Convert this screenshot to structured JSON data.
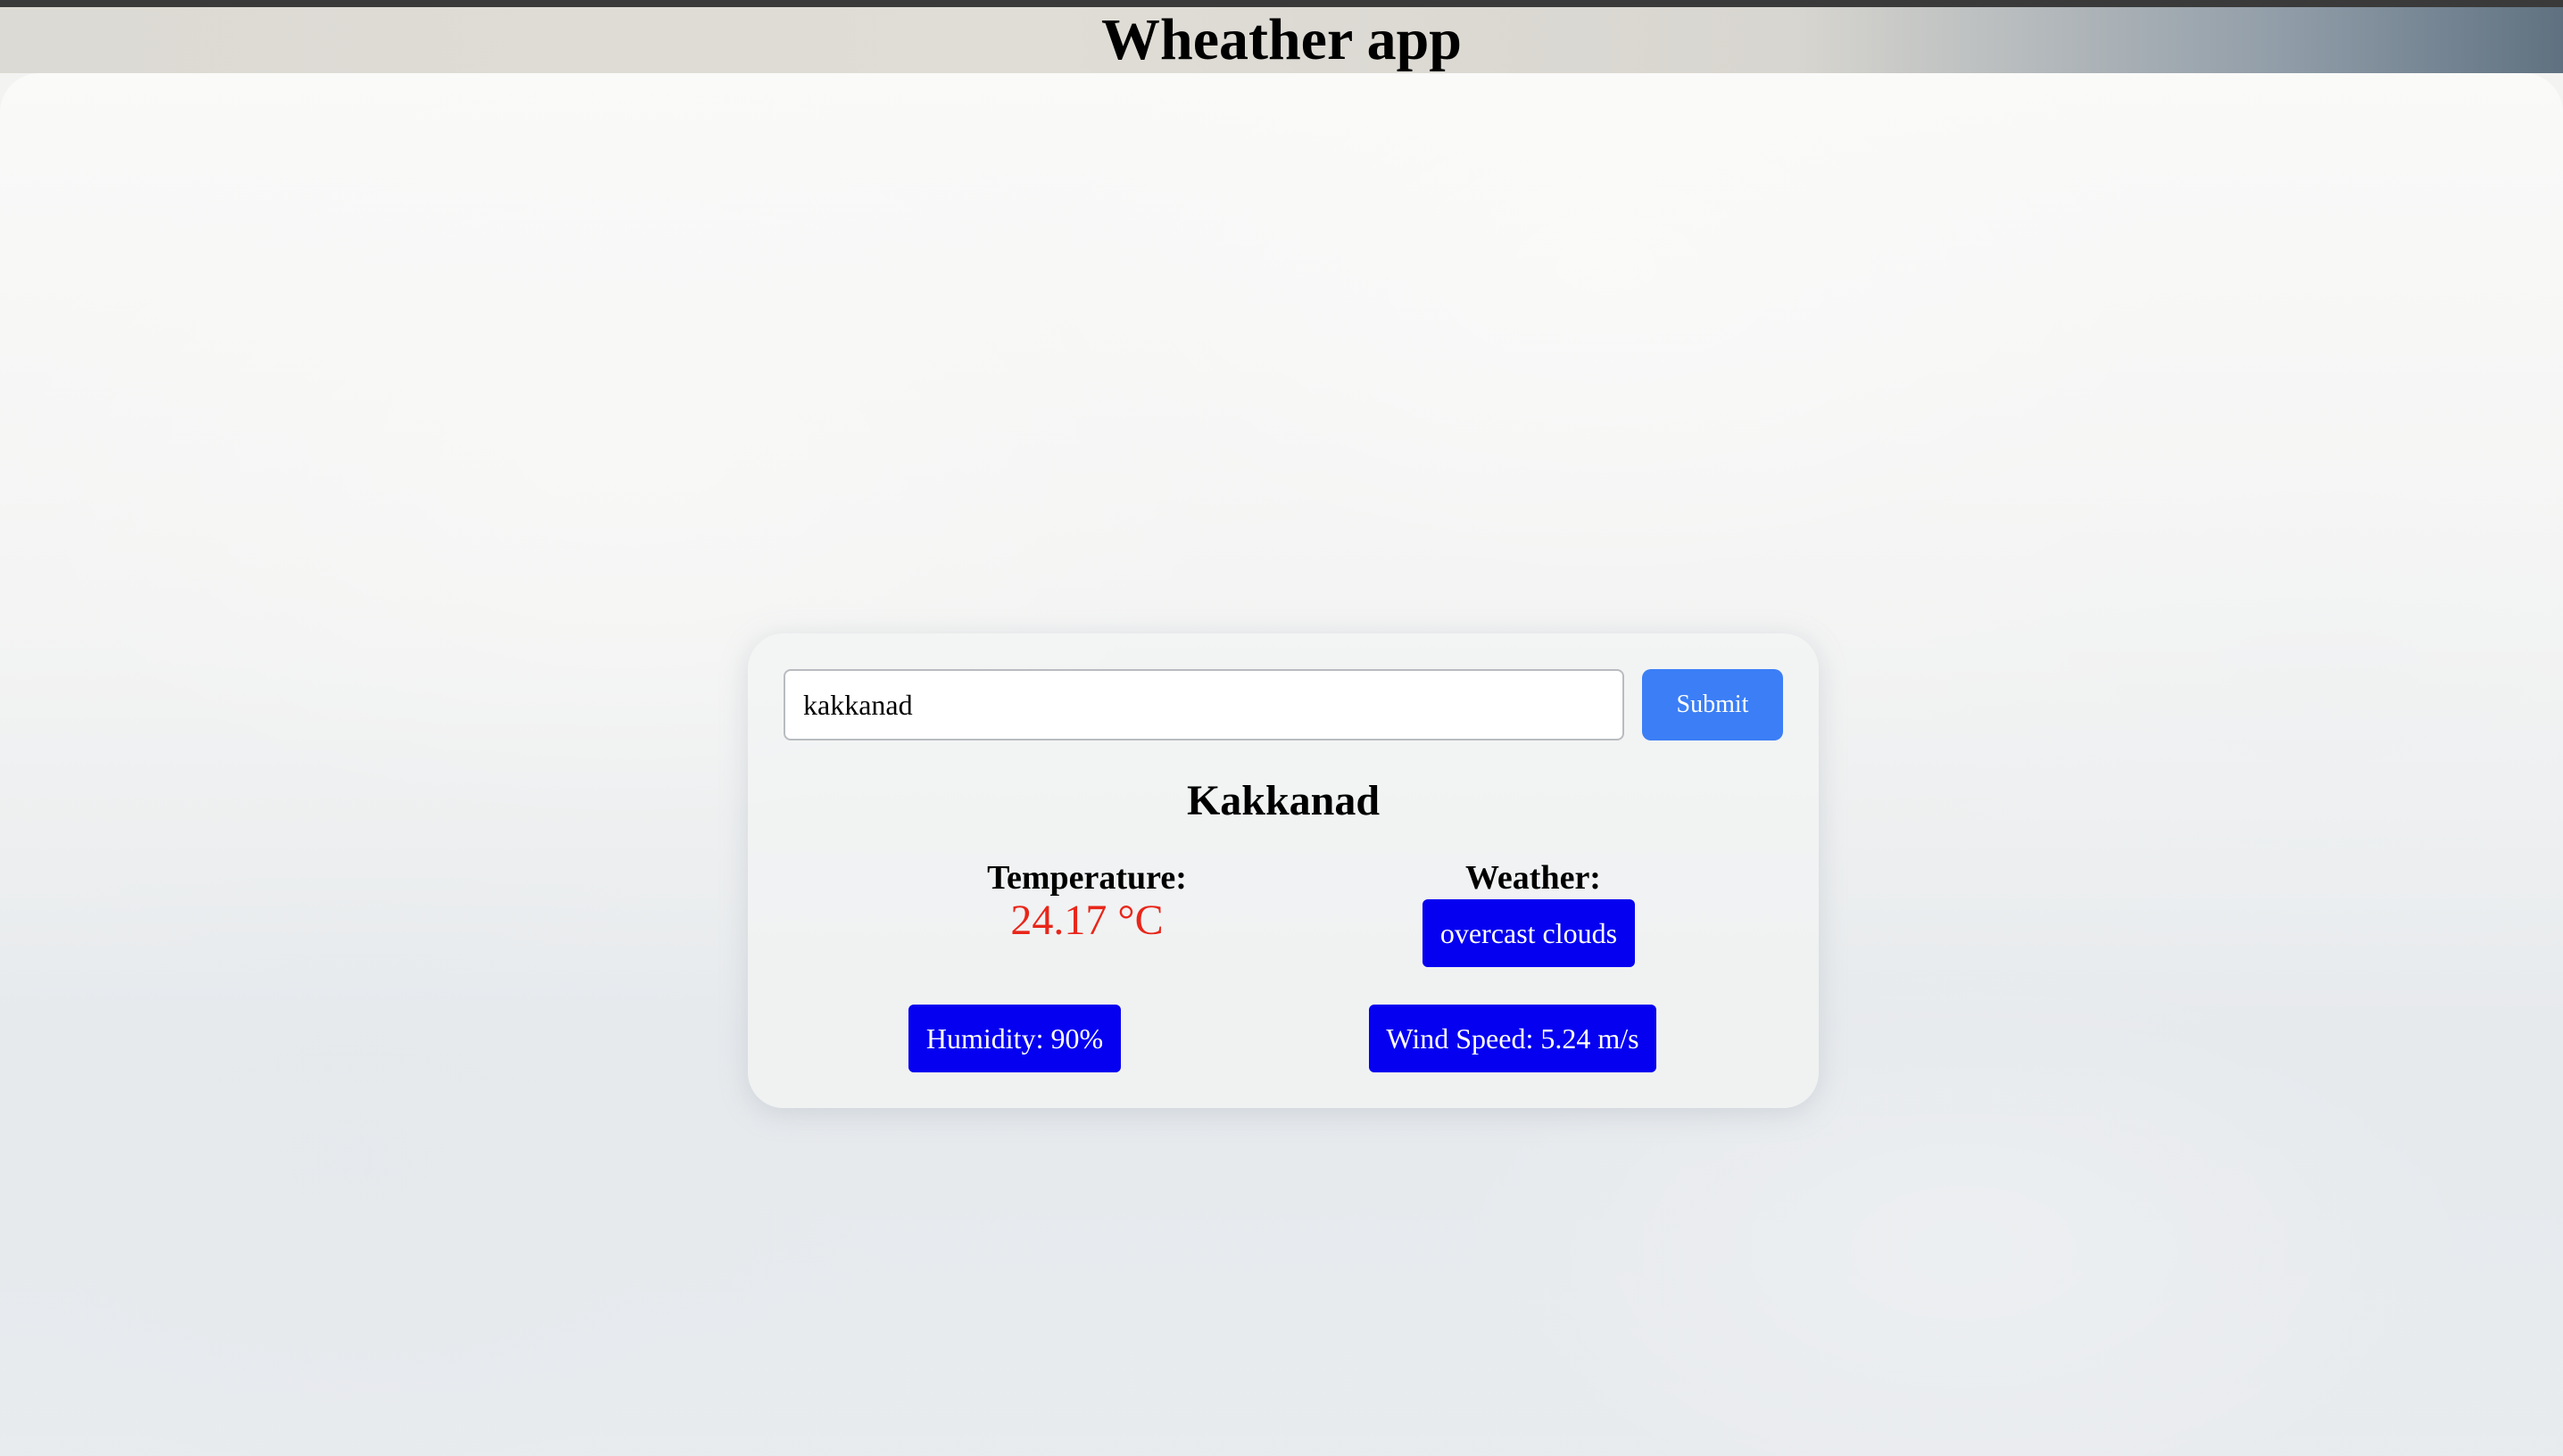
{
  "header": {
    "title": "Wheather app"
  },
  "search": {
    "value": "kakkanad",
    "submit_label": "Submit"
  },
  "weather": {
    "city": "Kakkanad",
    "temperature_label": "Temperature:",
    "temperature_value": "24.17 °C",
    "weather_label": "Weather:",
    "description": "overcast clouds",
    "humidity": "Humidity: 90%",
    "wind_speed": "Wind Speed: 5.24 m/s"
  },
  "colors": {
    "submit_button": "#3b7ef6",
    "badge_background": "#0500f0",
    "temperature_text": "#e8261a"
  }
}
